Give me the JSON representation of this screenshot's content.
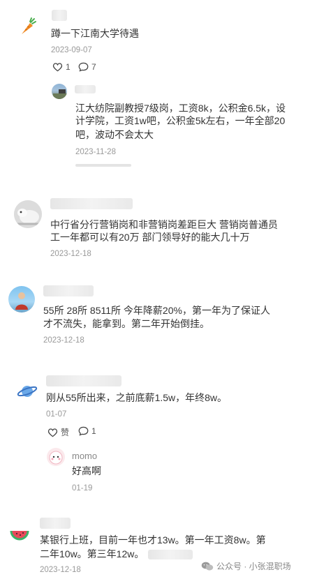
{
  "comments": [
    {
      "text": "蹲一下江南大学待遇",
      "date": "2023-09-07",
      "likes": "1",
      "replies": "7",
      "reply": {
        "text_line1": "江大纺院副教授7级岗，工资8k，公积金6.5k，设",
        "text_line2": "计学院，工资1w吧，公积金5k左右，一年全部20",
        "text_line3": "吧，波动不会太大",
        "date": "2023-11-28"
      }
    },
    {
      "text_line1": "中行省分行营销岗和非营销岗差距巨大 营销岗普通员",
      "text_line2": "工一年都可以有20万 部门领导好的能大几十万",
      "date": "2023-12-18"
    },
    {
      "text_line1": "55所 28所 8511所 今年降薪20%，第一年为了保证人",
      "text_line2": "才不流失，能拿到。第二年开始倒挂。",
      "date": "2023-12-18"
    },
    {
      "text": "刚从55所出来，之前底薪1.5w，年终8w。",
      "date": "01-07",
      "like_label": "赞",
      "replies": "1",
      "reply": {
        "name": "momo",
        "text": "好高啊",
        "date": "01-19"
      }
    },
    {
      "text_line1": "某银行上班，目前一年也才13w。第一年工资8w。第",
      "text_line2": "二年10w。第三年12w。",
      "date": "2023-12-18"
    }
  ],
  "watermark": {
    "text": "公众号 · 小张混职场",
    "icon": "wechat-icon"
  },
  "colors": {
    "date": "#999999",
    "text": "#333333"
  }
}
